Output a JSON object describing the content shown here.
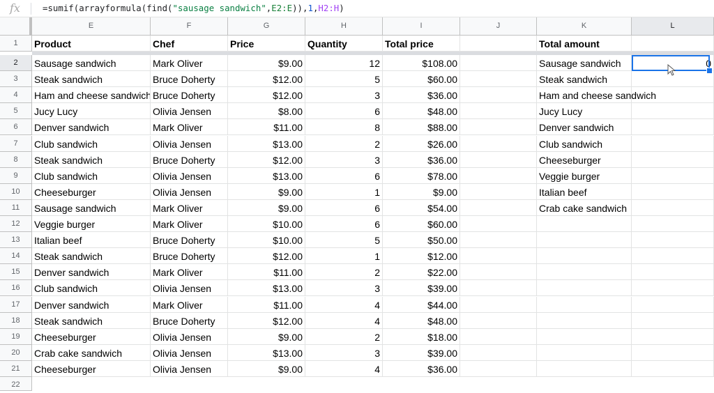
{
  "formula_bar": {
    "fx_label": "fx",
    "formula_parts": [
      {
        "text": "=sumif(arrayformula(find(",
        "cls": ""
      },
      {
        "text": "\"sausage sandwich\"",
        "cls": "f-str"
      },
      {
        "text": ",",
        "cls": ""
      },
      {
        "text": "E2:E",
        "cls": "f-ref1"
      },
      {
        "text": ")),",
        "cls": ""
      },
      {
        "text": "1",
        "cls": "f-num"
      },
      {
        "text": ",",
        "cls": ""
      },
      {
        "text": "H2:H",
        "cls": "f-ref2"
      },
      {
        "text": ")",
        "cls": ""
      }
    ]
  },
  "columns": [
    "E",
    "F",
    "G",
    "H",
    "I",
    "J",
    "K",
    "L"
  ],
  "selected_column": "L",
  "selected_row": 2,
  "headers": {
    "E": "Product",
    "F": "Chef",
    "G": "Price",
    "H": "Quantity",
    "I": "Total price",
    "J": "",
    "K": "Total amount",
    "L": ""
  },
  "rows": [
    {
      "n": 2,
      "product": "Sausage sandwich",
      "chef": "Mark Oliver",
      "price": "$9.00",
      "qty": "12",
      "total": "$108.00"
    },
    {
      "n": 3,
      "product": "Steak sandwich",
      "chef": "Bruce Doherty",
      "price": "$12.00",
      "qty": "5",
      "total": "$60.00"
    },
    {
      "n": 4,
      "product": "Ham and cheese sandwich",
      "chef": "Bruce Doherty",
      "price": "$12.00",
      "qty": "3",
      "total": "$36.00"
    },
    {
      "n": 5,
      "product": "Jucy Lucy",
      "chef": "Olivia Jensen",
      "price": "$8.00",
      "qty": "6",
      "total": "$48.00"
    },
    {
      "n": 6,
      "product": "Denver sandwich",
      "chef": "Mark Oliver",
      "price": "$11.00",
      "qty": "8",
      "total": "$88.00"
    },
    {
      "n": 7,
      "product": "Club sandwich",
      "chef": "Olivia Jensen",
      "price": "$13.00",
      "qty": "2",
      "total": "$26.00"
    },
    {
      "n": 8,
      "product": "Steak sandwich",
      "chef": "Bruce Doherty",
      "price": "$12.00",
      "qty": "3",
      "total": "$36.00"
    },
    {
      "n": 9,
      "product": "Club sandwich",
      "chef": "Olivia Jensen",
      "price": "$13.00",
      "qty": "6",
      "total": "$78.00"
    },
    {
      "n": 10,
      "product": "Cheeseburger",
      "chef": "Olivia Jensen",
      "price": "$9.00",
      "qty": "1",
      "total": "$9.00"
    },
    {
      "n": 11,
      "product": "Sausage sandwich",
      "chef": "Mark Oliver",
      "price": "$9.00",
      "qty": "6",
      "total": "$54.00"
    },
    {
      "n": 12,
      "product": "Veggie burger",
      "chef": "Mark Oliver",
      "price": "$10.00",
      "qty": "6",
      "total": "$60.00"
    },
    {
      "n": 13,
      "product": "Italian beef",
      "chef": "Bruce Doherty",
      "price": "$10.00",
      "qty": "5",
      "total": "$50.00"
    },
    {
      "n": 14,
      "product": "Steak sandwich",
      "chef": "Bruce Doherty",
      "price": "$12.00",
      "qty": "1",
      "total": "$12.00"
    },
    {
      "n": 15,
      "product": "Denver sandwich",
      "chef": "Mark Oliver",
      "price": "$11.00",
      "qty": "2",
      "total": "$22.00"
    },
    {
      "n": 16,
      "product": "Club sandwich",
      "chef": "Olivia Jensen",
      "price": "$13.00",
      "qty": "3",
      "total": "$39.00"
    },
    {
      "n": 17,
      "product": "Denver sandwich",
      "chef": "Mark Oliver",
      "price": "$11.00",
      "qty": "4",
      "total": "$44.00"
    },
    {
      "n": 18,
      "product": "Steak sandwich",
      "chef": "Bruce Doherty",
      "price": "$12.00",
      "qty": "4",
      "total": "$48.00"
    },
    {
      "n": 19,
      "product": "Cheeseburger",
      "chef": "Olivia Jensen",
      "price": "$9.00",
      "qty": "2",
      "total": "$18.00"
    },
    {
      "n": 20,
      "product": "Crab cake sandwich",
      "chef": "Olivia Jensen",
      "price": "$13.00",
      "qty": "3",
      "total": "$39.00"
    },
    {
      "n": 21,
      "product": "Cheeseburger",
      "chef": "Olivia Jensen",
      "price": "$9.00",
      "qty": "4",
      "total": "$36.00"
    }
  ],
  "summary_list": [
    "Sausage sandwich",
    "Steak sandwich",
    "Ham and cheese sandwich",
    "Jucy Lucy",
    "Denver sandwich",
    "Club sandwich",
    "Cheeseburger",
    "Veggie burger",
    "Italian beef",
    "Crab cake sandwich"
  ],
  "active_cell_value": "0",
  "partial_row_number": "22",
  "colors": {
    "selection": "#1a73e8",
    "header_bg": "#f8f9fa",
    "grid": "#e2e3e3"
  }
}
